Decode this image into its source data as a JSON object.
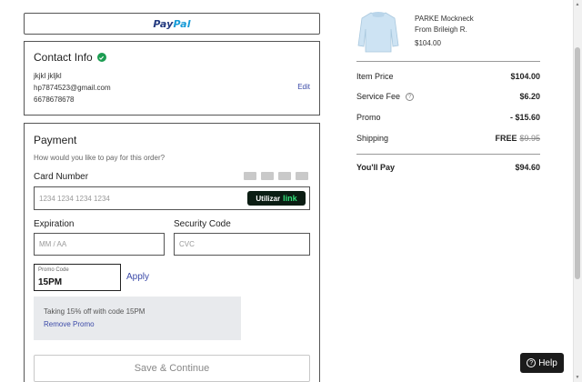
{
  "paypal": {
    "pay": "Pay",
    "pal": "Pal"
  },
  "contact": {
    "title": "Contact Info",
    "name": "jkjkl jkljkl",
    "email": "hp7874523@gmail.com",
    "phone": "6678678678",
    "edit_label": "Edit"
  },
  "payment": {
    "title": "Payment",
    "question": "How would you like to pay for this order?",
    "card_label": "Card Number",
    "card_placeholder": "1234 1234 1234 1234",
    "link_button_text": "Utilizar",
    "link_brand": "link",
    "expiration_label": "Expiration",
    "expiration_placeholder": "MM / AA",
    "security_label": "Security Code",
    "security_placeholder": "CVC",
    "card_brand_icons": [
      "visa-icon",
      "mastercard-icon",
      "amex-icon",
      "discover-icon"
    ]
  },
  "promo": {
    "label": "Promo Code",
    "value": "15PM",
    "apply_label": "Apply",
    "notice_text": "Taking 15% off with code 15PM",
    "remove_label": "Remove Promo"
  },
  "save_label": "Save & Continue",
  "product": {
    "name": "PARKE Mockneck",
    "brand": "From Brileigh R.",
    "price": "$104.00"
  },
  "summary": {
    "item_price_label": "Item Price",
    "item_price": "$104.00",
    "service_fee_label": "Service Fee",
    "service_fee": "$6.20",
    "promo_label": "Promo",
    "promo_value": "- $15.60",
    "shipping_label": "Shipping",
    "shipping_value": "FREE",
    "shipping_original": "$9.95",
    "total_label": "You'll Pay",
    "total_value": "$94.60"
  },
  "help_label": "Help",
  "colors": {
    "link_blue": "#3b4aa8",
    "check_green": "#1d9d52",
    "link_green": "#33e07a"
  }
}
